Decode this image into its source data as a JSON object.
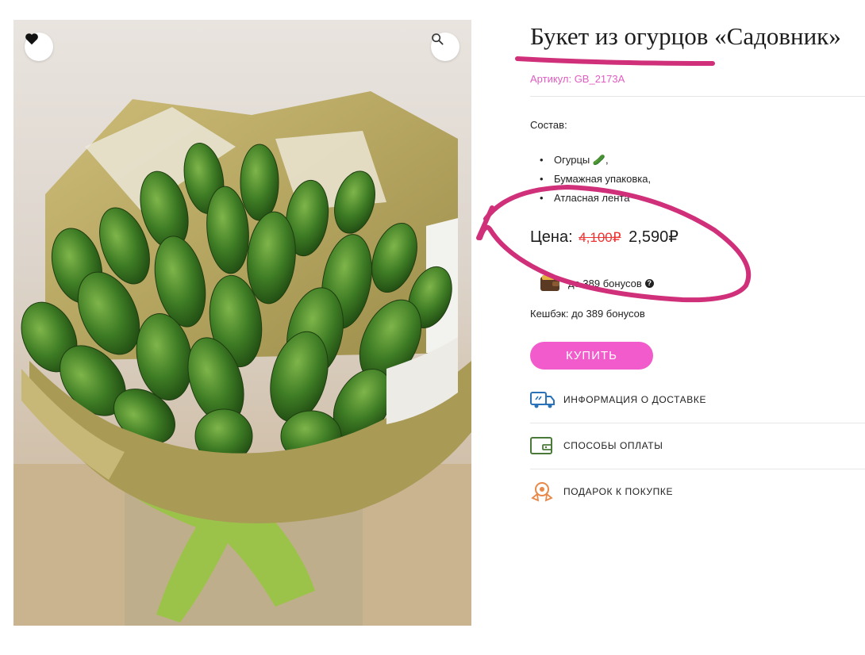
{
  "product": {
    "title": "Букет из огурцов «Садовник»",
    "sku": "Артикул: GB_2173A"
  },
  "composition": {
    "label": "Состав:",
    "items": [
      "Огурцы 🥒,",
      "Бумажная упаковка,",
      "Атласная лента"
    ]
  },
  "price": {
    "label": "Цена:",
    "old": "4,100₽",
    "new": "2,590₽"
  },
  "bonus": {
    "text": "до 389 бонусов",
    "cashback": "Кешбэк: до 389 бонусов"
  },
  "actions": {
    "buy": "КУПИТЬ"
  },
  "info_links": [
    {
      "label": "ИНФОРМАЦИЯ О ДОСТАВКЕ",
      "icon": "delivery-truck-icon"
    },
    {
      "label": "СПОСОБЫ ОПЛАТЫ",
      "icon": "wallet-payment-icon"
    },
    {
      "label": "ПОДАРОК К ПОКУПКЕ",
      "icon": "gift-badge-icon"
    }
  ],
  "colors": {
    "accent_pink": "#f25bcb",
    "sku_pink": "#e05cc0",
    "old_price_red": "#e33",
    "annotation_magenta": "#d0307a",
    "icon_blue": "#2a72b8",
    "icon_green": "#4a7a3a",
    "icon_orange": "#e8894a"
  }
}
